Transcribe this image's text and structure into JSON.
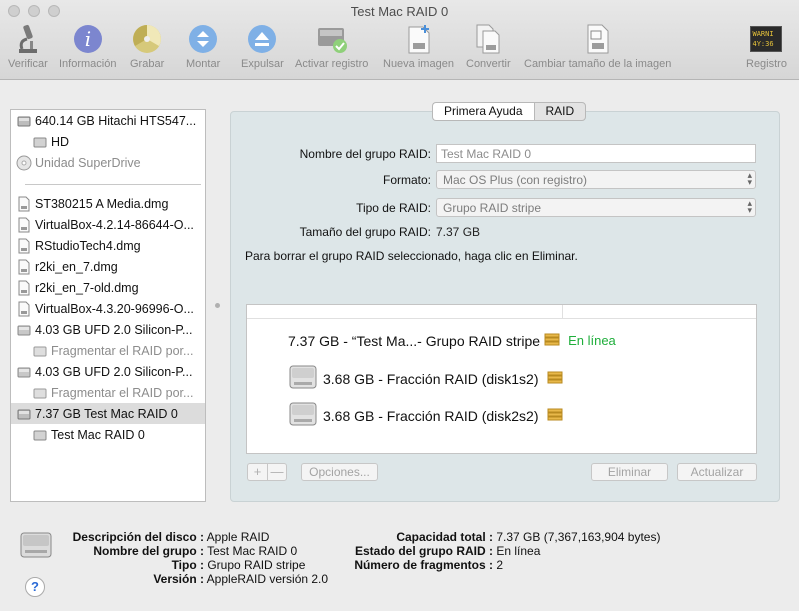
{
  "window": {
    "title": "Test Mac RAID 0"
  },
  "toolbar": {
    "items": [
      {
        "label": "Verificar",
        "icon": "microscope-icon"
      },
      {
        "label": "Información",
        "icon": "info-icon"
      },
      {
        "label": "Grabar",
        "icon": "burn-disc-icon"
      },
      {
        "label": "Montar",
        "icon": "mount-icon"
      },
      {
        "label": "Expulsar",
        "icon": "eject-icon"
      },
      {
        "label": "Activar registro",
        "icon": "enable-journaling-icon"
      },
      {
        "label": "Nueva imagen",
        "icon": "new-image-icon"
      },
      {
        "label": "Convertir",
        "icon": "convert-icon"
      },
      {
        "label": "Cambiar tamaño de la imagen",
        "icon": "resize-image-icon"
      },
      {
        "label": "Registro",
        "icon": "log-icon"
      }
    ],
    "log_icon_text": "WARNI\n4Y:36"
  },
  "sidebar": {
    "items": [
      {
        "label": "640.14 GB Hitachi HTS547...",
        "icon": "hard-disk-icon"
      },
      {
        "label": "HD",
        "icon": "volume-icon"
      },
      {
        "label": "Unidad SuperDrive",
        "icon": "superdrive-icon"
      },
      {
        "label": "ST380215 A Media.dmg",
        "icon": "disk-image-icon"
      },
      {
        "label": "VirtualBox-4.2.14-86644-O...",
        "icon": "disk-image-icon"
      },
      {
        "label": "RStudioTech4.dmg",
        "icon": "disk-image-icon"
      },
      {
        "label": "r2ki_en_7.dmg",
        "icon": "disk-image-icon"
      },
      {
        "label": "r2ki_en_7-old.dmg",
        "icon": "disk-image-icon"
      },
      {
        "label": "VirtualBox-4.3.20-96996-O...",
        "icon": "disk-image-icon"
      },
      {
        "label": "4.03 GB UFD 2.0 Silicon-P...",
        "icon": "usb-disk-icon"
      },
      {
        "label": "Fragmentar el RAID por...",
        "icon": "volume-icon"
      },
      {
        "label": "4.03 GB UFD 2.0 Silicon-P...",
        "icon": "usb-disk-icon"
      },
      {
        "label": "Fragmentar el RAID por...",
        "icon": "volume-icon"
      },
      {
        "label": "7.37 GB Test Mac RAID 0",
        "icon": "raid-disk-icon"
      },
      {
        "label": "Test Mac RAID 0",
        "icon": "volume-icon"
      }
    ]
  },
  "tabs": {
    "first_aid": "Primera Ayuda",
    "raid": "RAID"
  },
  "form": {
    "name_label": "Nombre del grupo RAID:",
    "name_value": "Test Mac RAID 0",
    "format_label": "Formato:",
    "format_value": "Mac OS Plus (con registro)",
    "type_label": "Tipo de RAID:",
    "type_value": "Grupo RAID stripe",
    "size_label": "Tamaño del grupo RAID:",
    "size_value": "7.37 GB",
    "delete_note": "Para borrar el grupo RAID seleccionado, haga clic en Eliminar."
  },
  "raid_set": {
    "title": "7.37 GB - “Test Ma...- Grupo RAID stripe",
    "status": "En línea",
    "members": [
      {
        "label": "3.68 GB - Fracción RAID (disk1s2)"
      },
      {
        "label": "3.68 GB - Fracción RAID (disk2s2)"
      }
    ]
  },
  "buttons": {
    "add": "+",
    "remove": "—",
    "options": "Opciones...",
    "delete": "Eliminar",
    "update": "Actualizar"
  },
  "info": {
    "desc_k": "Descripción del disco :",
    "desc_v": "Apple RAID",
    "group_k": "Nombre del grupo :",
    "group_v": "Test Mac RAID 0",
    "type_k": "Tipo :",
    "type_v": "Grupo RAID stripe",
    "version_k": "Versión :",
    "version_v": "AppleRAID versión 2.0",
    "cap_k": "Capacidad total :",
    "cap_v": "7.37 GB (7,367,163,904 bytes)",
    "state_k": "Estado del grupo RAID :",
    "state_v": "En línea",
    "frag_k": "Número de fragmentos :",
    "frag_v": "2"
  },
  "help": "?"
}
